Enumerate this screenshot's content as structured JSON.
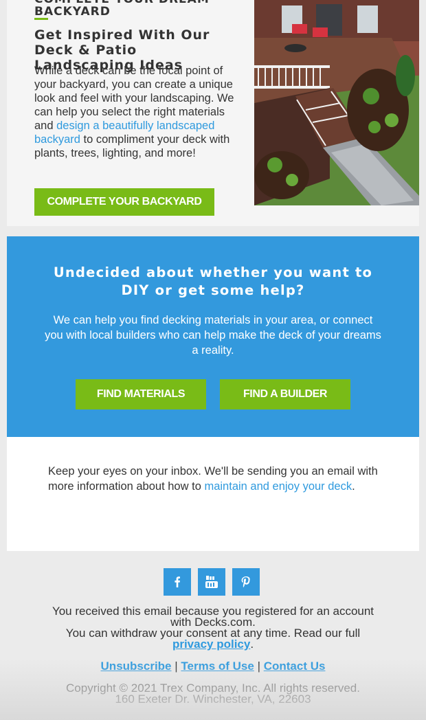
{
  "dream": {
    "eyebrow": "COMPLETE YOUR DREAM BACKYARD",
    "title": "Get Inspired With Our Deck & Patio Landscaping Ideas",
    "body_before": "While a deck can be the focal point of your backyard, you can create a unique look and feel with your landscaping. We can help you select the right materials and ",
    "body_link": "design a beautifully landscaped backyard",
    "body_after": " to compliment your deck with plants, trees, lighting, and more!",
    "button_label": "COMPLETE YOUR BACKYARD"
  },
  "help": {
    "title": "Undecided about whether you want to DIY or get some help?",
    "body": "We can help you find decking materials in your area, or connect you with local builders who can help make the deck of your dreams a reality.",
    "find_materials_label": "FIND MATERIALS",
    "find_builder_label": "FIND A BUILDER"
  },
  "inbox": {
    "text_before": "Keep your eyes on your inbox. We'll be sending you an email with more information about how to ",
    "link": "maintain and enjoy your deck",
    "text_after": "."
  },
  "social": {
    "icons": [
      "facebook-icon",
      "youtube-icon",
      "pinterest-icon"
    ],
    "color": "#3399dd"
  },
  "footer": {
    "received": "You received this email because you registered for an account with Decks.com.",
    "withdraw": "You can withdraw your consent at any time. Read our full",
    "privacy_link": "privacy policy",
    "privacy_after": ".",
    "unsubscribe": "Unsubscribe",
    "terms": "Terms of Use",
    "contact": "Contact Us",
    "sep1": " | ",
    "sep2": " | ",
    "copyright": "Copyright © 2021 Trex Company, Inc. All rights reserved.",
    "address": "160 Exeter Dr. Winchester, VA, 22603"
  },
  "colors": {
    "accent_green": "#79bb17",
    "brand_blue": "#3399dd",
    "link_blue": "#2f9ade"
  }
}
